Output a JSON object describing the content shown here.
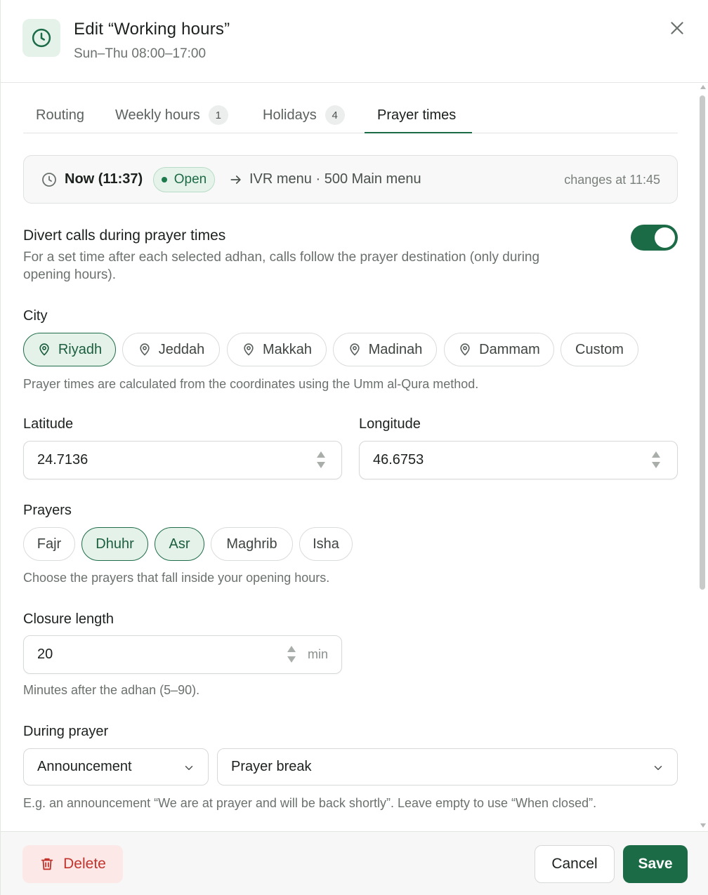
{
  "header": {
    "title": "Edit “Working hours”",
    "subtitle": "Sun–Thu 08:00–17:00",
    "icon": "clock-icon",
    "close_icon": "close-icon"
  },
  "tabs": [
    {
      "label": "Routing",
      "count": null,
      "active": false
    },
    {
      "label": "Weekly hours",
      "count": "1",
      "active": false
    },
    {
      "label": "Holidays",
      "count": "4",
      "active": false
    },
    {
      "label": "Prayer times",
      "count": null,
      "active": true
    }
  ],
  "status": {
    "now": "Now (11:37)",
    "state": "Open",
    "destination": "IVR menu · 500 Main menu",
    "changes": "changes at 11:45"
  },
  "divert": {
    "title": "Divert calls during prayer times",
    "help_line1": "For a set time after each selected adhan, calls follow the prayer destination (only during",
    "help_line2": "opening hours).",
    "enabled": true
  },
  "city": {
    "label": "City",
    "options": [
      "Riyadh",
      "Jeddah",
      "Makkah",
      "Madinah",
      "Dammam",
      "Custom"
    ],
    "selected": "Riyadh",
    "help": "Prayer times are calculated from the coordinates using the Umm al-Qura method."
  },
  "coords": {
    "latitude_label": "Latitude",
    "latitude": "24.7136",
    "longitude_label": "Longitude",
    "longitude": "46.6753"
  },
  "prayers": {
    "label": "Prayers",
    "options": [
      "Fajr",
      "Dhuhr",
      "Asr",
      "Maghrib",
      "Isha"
    ],
    "selected": [
      "Dhuhr",
      "Asr"
    ],
    "help": "Choose the prayers that fall inside your opening hours."
  },
  "closure": {
    "label": "Closure length",
    "value": "20",
    "unit": "min",
    "help": "Minutes after the adhan (5–90)."
  },
  "during": {
    "label": "During prayer",
    "type": "Announcement",
    "target": "Prayer break",
    "help": "E.g. an announcement “We are at prayer and will be back shortly”. Leave empty to use “When closed”."
  },
  "footer": {
    "delete": "Delete",
    "cancel": "Cancel",
    "save": "Save"
  },
  "colors": {
    "accent": "#1c6b47",
    "accent_soft": "#e5f2ea",
    "danger": "#c0342d",
    "danger_soft": "#fce8e7"
  }
}
